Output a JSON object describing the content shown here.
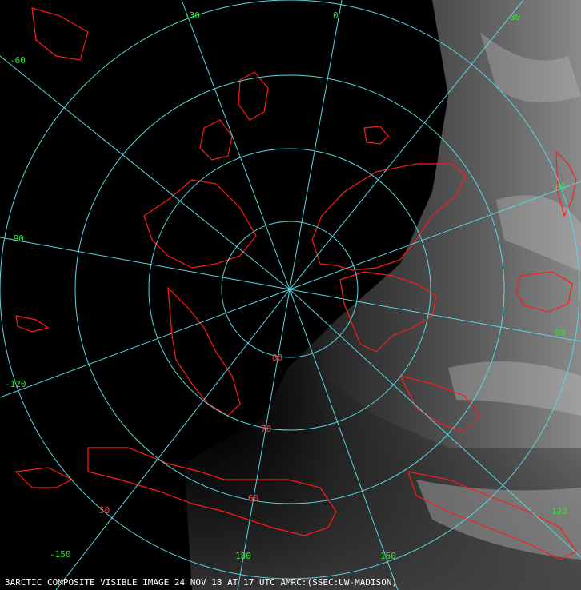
{
  "caption": {
    "frame_number": "3",
    "text": "ARCTIC COMPOSITE VISIBLE IMAGE 24 NOV 18 AT 17 UTC AMRC:(SSEC:UW-MADISON)"
  },
  "projection": {
    "type": "polar-stereographic",
    "pole": "north",
    "latitude_circles": [
      80,
      70,
      60,
      50
    ],
    "meridian_spacing_deg": 30
  },
  "latitude_labels": [
    "80",
    "70",
    "60",
    "50"
  ],
  "longitude_labels": {
    "lon_0": "0",
    "lon_30": "30",
    "lon_60": "60",
    "lon_90": "90",
    "lon_120": "120",
    "lon_150": "150",
    "lon_180": "180",
    "lon_m150": "-150",
    "lon_m120": "-120",
    "lon_m90": "-90",
    "lon_m60": "-60",
    "lon_m30": "-30"
  },
  "colors": {
    "background": "#000000",
    "grid": "#5ad8e0",
    "coastline": "#ff1a1a",
    "labels": "#36e036",
    "caption": "#ffffff"
  }
}
